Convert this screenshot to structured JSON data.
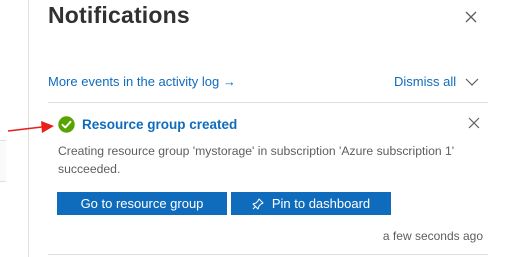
{
  "panel": {
    "title": "Notifications",
    "activity_link": "More events in the activity log →",
    "dismiss_label": "Dismiss all"
  },
  "notification": {
    "title": "Resource group created",
    "description": "Creating resource group 'mystorage' in subscription 'Azure subscription 1' succeeded.",
    "primary_button": "Go to resource group",
    "pin_button": "Pin to dashboard",
    "timestamp": "a few seconds ago"
  },
  "colors": {
    "accent": "#0f6cbd",
    "success": "#57a300",
    "annotation_arrow": "#e8201a"
  },
  "icons": [
    "close-icon",
    "chevron-down-icon",
    "success-check-icon",
    "pin-icon",
    "red-annotation-arrow"
  ]
}
